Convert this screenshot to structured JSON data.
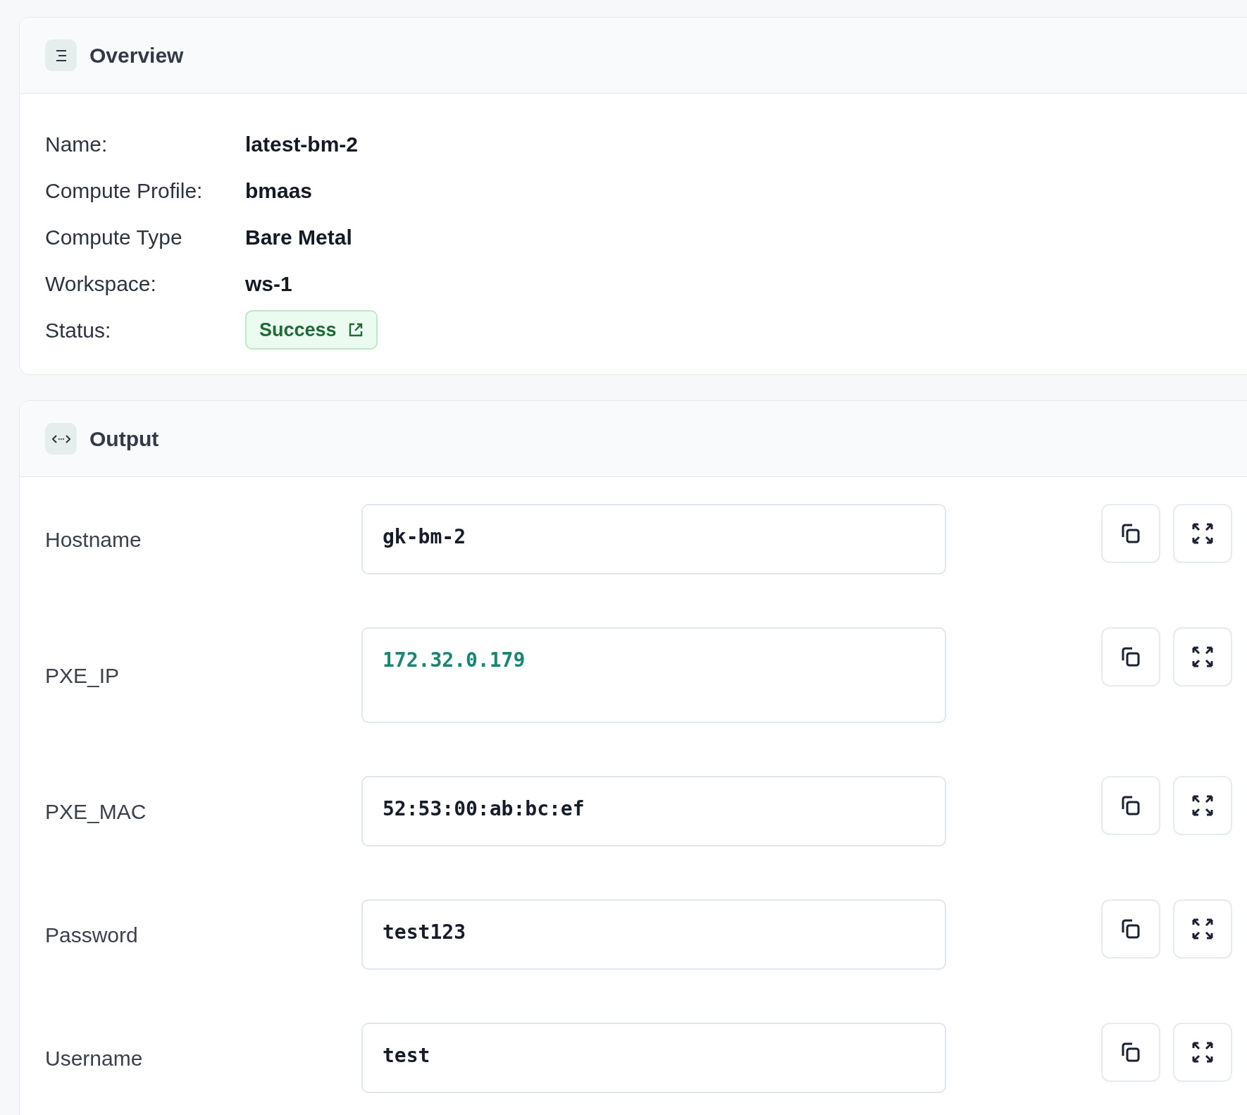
{
  "overview": {
    "title": "Overview",
    "fields": [
      {
        "label": "Name:",
        "value": "latest-bm-2"
      },
      {
        "label": "Compute Profile:",
        "value": "bmaas"
      },
      {
        "label": "Compute Type",
        "value": "Bare Metal"
      },
      {
        "label": "Workspace:",
        "value": "ws-1"
      }
    ],
    "status": {
      "label": "Status:",
      "value": "Success"
    }
  },
  "output": {
    "title": "Output",
    "rows": [
      {
        "label": "Hostname",
        "value": "gk-bm-2",
        "kind": "text"
      },
      {
        "label": "PXE_IP",
        "value": "172.32.0.179",
        "kind": "numeric"
      },
      {
        "label": "PXE_MAC",
        "value": "52:53:00:ab:bc:ef",
        "kind": "text"
      },
      {
        "label": "Password",
        "value": "test123",
        "kind": "text"
      },
      {
        "label": "Username",
        "value": "test",
        "kind": "text"
      }
    ]
  }
}
